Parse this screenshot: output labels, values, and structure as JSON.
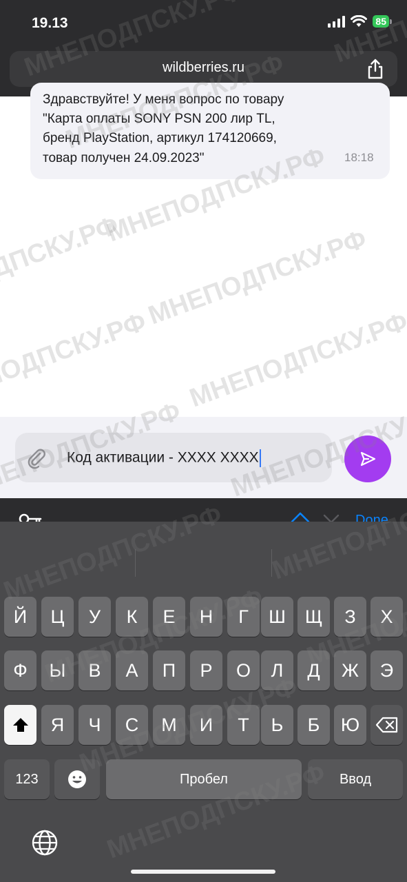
{
  "status_bar": {
    "time": "19.13",
    "battery": "85"
  },
  "browser": {
    "url": "wildberries.ru"
  },
  "chat": {
    "message_lines": [
      "Здравствуйте! У меня вопрос по товару",
      "\"Карта оплаты SONY PSN 200 лир TL,",
      "бренд PlayStation, артикул 174120669,",
      "товар получен 24.09.2023\""
    ],
    "message_time": "18:18"
  },
  "composer": {
    "text": "Код активации - XXXX XXXX"
  },
  "keyboard_toolbar": {
    "done": "Done"
  },
  "keyboard": {
    "row1": [
      "Й",
      "Ц",
      "У",
      "К",
      "Е",
      "Н",
      "Г",
      "Ш",
      "Щ",
      "З",
      "Х"
    ],
    "row2": [
      "Ф",
      "Ы",
      "В",
      "А",
      "П",
      "Р",
      "О",
      "Л",
      "Д",
      "Ж",
      "Э"
    ],
    "row3": [
      "Я",
      "Ч",
      "С",
      "М",
      "И",
      "Т",
      "Ь",
      "Б",
      "Ю"
    ],
    "numbers_key": "123",
    "space_key": "Пробел",
    "return_key": "Ввод"
  },
  "watermark": "МНЕПОДПСКУ.РФ",
  "colors": {
    "send_button": "#a33cf0",
    "done_link": "#0a84ff",
    "battery": "#34c759"
  }
}
